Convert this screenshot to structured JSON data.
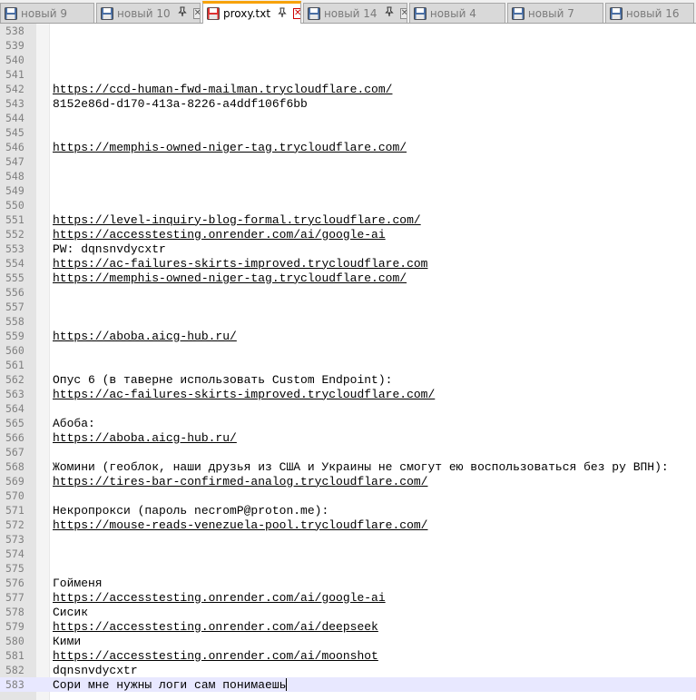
{
  "tabs": [
    {
      "label": "новый 9",
      "active": false,
      "pinned": false,
      "closable": false
    },
    {
      "label": "новый 10",
      "active": false,
      "pinned": true,
      "closable": true
    },
    {
      "label": "proxy.txt",
      "active": true,
      "pinned": true,
      "closable": true
    },
    {
      "label": "новый 14",
      "active": false,
      "pinned": true,
      "closable": true
    },
    {
      "label": "новый 4",
      "active": false,
      "pinned": false,
      "closable": false
    },
    {
      "label": "новый 7",
      "active": false,
      "pinned": false,
      "closable": false
    },
    {
      "label": "новый 16",
      "active": false,
      "pinned": false,
      "closable": false
    }
  ],
  "colors": {
    "active_tab_accent": "#f7a20b",
    "current_line": "#e8e8ff",
    "saved_icon": "#4a6fa5",
    "unsaved_icon": "#d33"
  },
  "lines": [
    {
      "n": "538",
      "text": ""
    },
    {
      "n": "539",
      "text": ""
    },
    {
      "n": "540",
      "text": ""
    },
    {
      "n": "541",
      "text": ""
    },
    {
      "n": "542",
      "text": "https://ccd-human-fwd-mailman.trycloudflare.com/",
      "link": true
    },
    {
      "n": "543",
      "text": "8152e86d-d170-413a-8226-a4ddf106f6bb"
    },
    {
      "n": "544",
      "text": ""
    },
    {
      "n": "545",
      "text": ""
    },
    {
      "n": "546",
      "text": "https://memphis-owned-niger-tag.trycloudflare.com/",
      "link": true
    },
    {
      "n": "547",
      "text": ""
    },
    {
      "n": "548",
      "text": ""
    },
    {
      "n": "549",
      "text": ""
    },
    {
      "n": "550",
      "text": ""
    },
    {
      "n": "551",
      "text": "https://level-inquiry-blog-formal.trycloudflare.com/",
      "link": true
    },
    {
      "n": "552",
      "text": "https://accesstesting.onrender.com/ai/google-ai",
      "link": true
    },
    {
      "n": "553",
      "text": "PW: dqnsnvdycxtr"
    },
    {
      "n": "554",
      "text": "https://ac-failures-skirts-improved.trycloudflare.com",
      "link": true
    },
    {
      "n": "555",
      "text": "https://memphis-owned-niger-tag.trycloudflare.com/",
      "link": true
    },
    {
      "n": "556",
      "text": ""
    },
    {
      "n": "557",
      "text": ""
    },
    {
      "n": "558",
      "text": ""
    },
    {
      "n": "559",
      "text": "https://aboba.aicg-hub.ru/",
      "link": true
    },
    {
      "n": "560",
      "text": ""
    },
    {
      "n": "561",
      "text": ""
    },
    {
      "n": "562",
      "text": "Опус 6 (в таверне использовать Custom Endpoint):"
    },
    {
      "n": "563",
      "text": "https://ac-failures-skirts-improved.trycloudflare.com/",
      "link": true
    },
    {
      "n": "564",
      "text": ""
    },
    {
      "n": "565",
      "text": "Абоба:"
    },
    {
      "n": "566",
      "text": "https://aboba.aicg-hub.ru/",
      "link": true
    },
    {
      "n": "567",
      "text": ""
    },
    {
      "n": "568",
      "text": "Жомини (геоблок, наши друзья из США и Украины не смогут ею воспользоваться без ру ВПН):"
    },
    {
      "n": "569",
      "text": "https://tires-bar-confirmed-analog.trycloudflare.com/",
      "link": true
    },
    {
      "n": "570",
      "text": ""
    },
    {
      "n": "571",
      "text": "Некропрокси (пароль necromP@proton.me):"
    },
    {
      "n": "572",
      "text": "https://mouse-reads-venezuela-pool.trycloudflare.com/",
      "link": true
    },
    {
      "n": "573",
      "text": ""
    },
    {
      "n": "574",
      "text": ""
    },
    {
      "n": "575",
      "text": ""
    },
    {
      "n": "576",
      "text": "Гойменя"
    },
    {
      "n": "577",
      "text": "https://accesstesting.onrender.com/ai/google-ai",
      "link": true
    },
    {
      "n": "578",
      "text": "Сисик"
    },
    {
      "n": "579",
      "text": "https://accesstesting.onrender.com/ai/deepseek",
      "link": true
    },
    {
      "n": "580",
      "text": "Кими"
    },
    {
      "n": "581",
      "text": "https://accesstesting.onrender.com/ai/moonshot",
      "link": true
    },
    {
      "n": "582",
      "text": "dqnsnvdycxtr"
    },
    {
      "n": "583",
      "text": "Сори мне нужны логи сам понимаешь",
      "current": true
    }
  ]
}
